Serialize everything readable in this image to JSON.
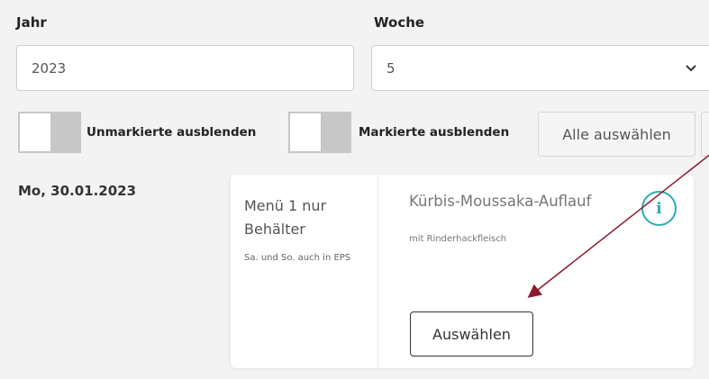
{
  "filters": {
    "year_label": "Jahr",
    "year_value": "2023",
    "week_label": "Woche",
    "week_value": "5"
  },
  "toggles": {
    "unmarked_label": "Unmarkierte ausblenden",
    "marked_label": "Markierte ausblenden"
  },
  "actions": {
    "select_all_label": "Alle auswählen"
  },
  "day": {
    "date": "Mo, 30.01.2023",
    "menu": {
      "title": "Menü 1 nur Behälter",
      "note": "Sa. und So. auch in EPS",
      "dish_name": "Kürbis-Moussaka-Auflauf",
      "dish_sub": "mit Rinderhackfleisch",
      "info_glyph": "i",
      "choose_label": "Auswählen"
    }
  },
  "colors": {
    "info_accent": "#2fa9b5",
    "annotation_arrow": "#8b1a2b"
  }
}
